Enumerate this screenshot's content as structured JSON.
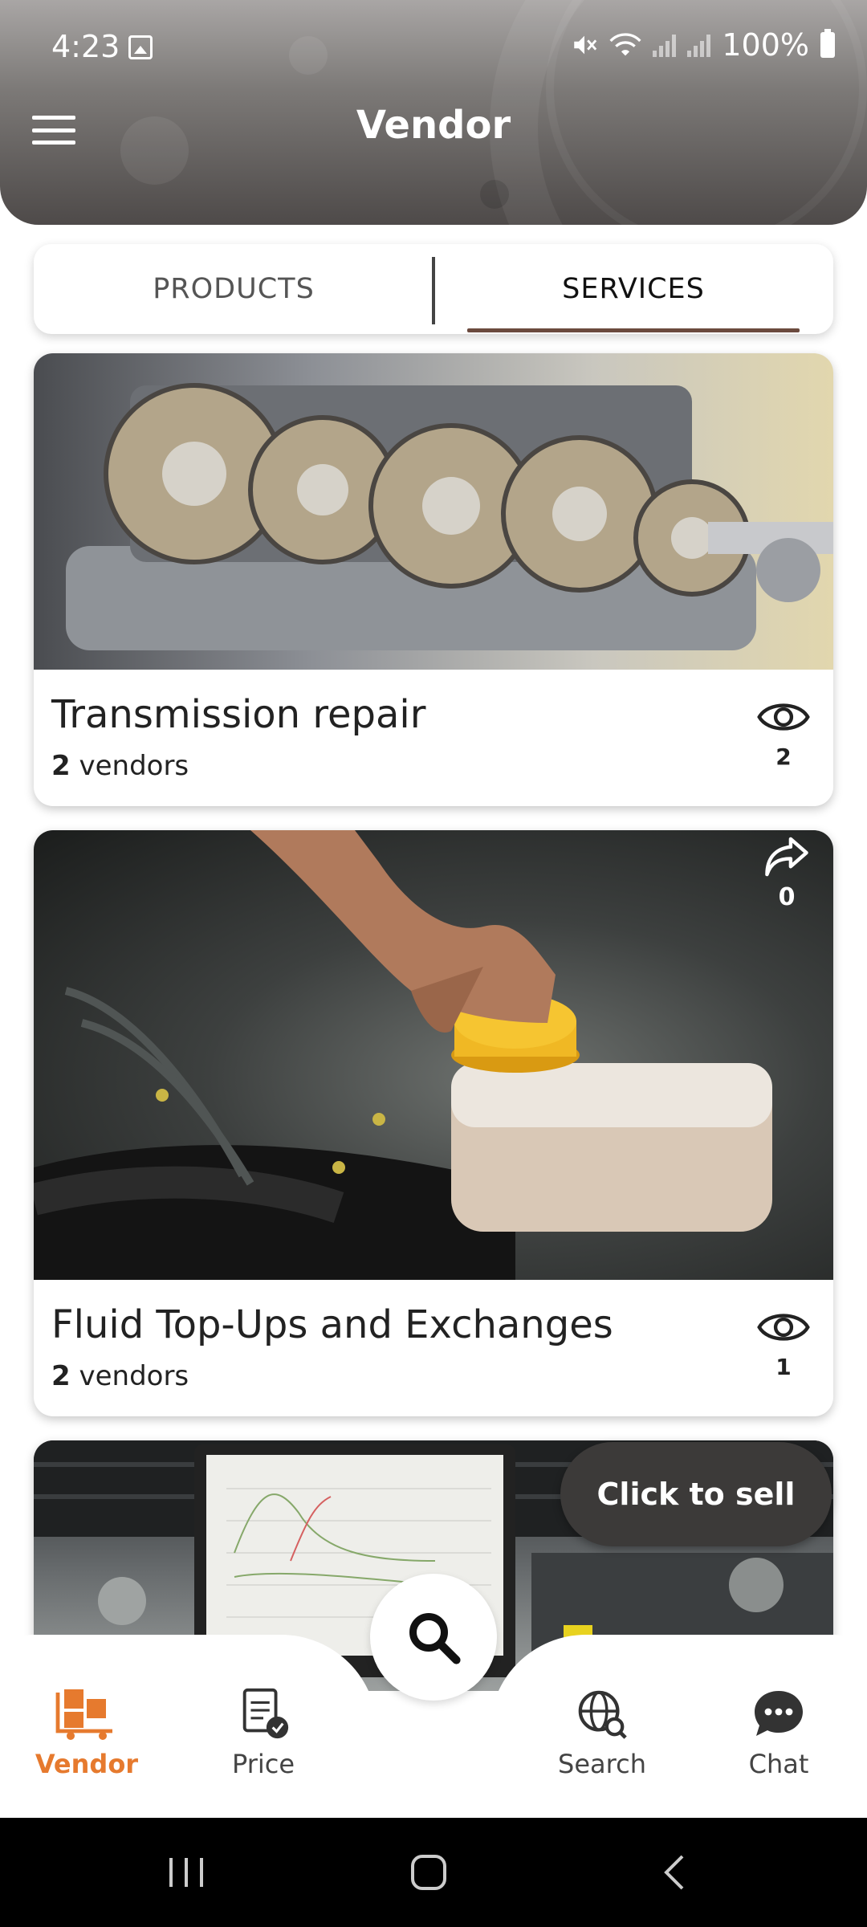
{
  "status_bar": {
    "time": "4:23",
    "battery": "100%"
  },
  "header": {
    "title": "Vendor"
  },
  "tabs": [
    {
      "label": "PRODUCTS",
      "selected": false
    },
    {
      "label": "SERVICES",
      "selected": true
    }
  ],
  "cards": [
    {
      "title": "Transmission repair",
      "vendor_count": "2",
      "vendor_label": "vendors",
      "views": "2"
    },
    {
      "title": "Fluid Top-Ups and Exchanges",
      "vendor_count": "2",
      "vendor_label": "vendors",
      "views": "1",
      "shares": "0"
    }
  ],
  "sell_button": {
    "label": "Click to sell"
  },
  "bottom_nav": [
    {
      "label": "Vendor",
      "icon": "vendor-boxes-icon",
      "active": true
    },
    {
      "label": "Price",
      "icon": "price-document-icon",
      "active": false
    },
    {
      "label": "Search",
      "icon": "globe-search-icon",
      "active": false
    },
    {
      "label": "Chat",
      "icon": "chat-bubble-icon",
      "active": false
    }
  ],
  "colors": {
    "accent": "#e67a2e",
    "tab_underline": "#6b4a3e",
    "header_dark": "#4e4a49"
  }
}
